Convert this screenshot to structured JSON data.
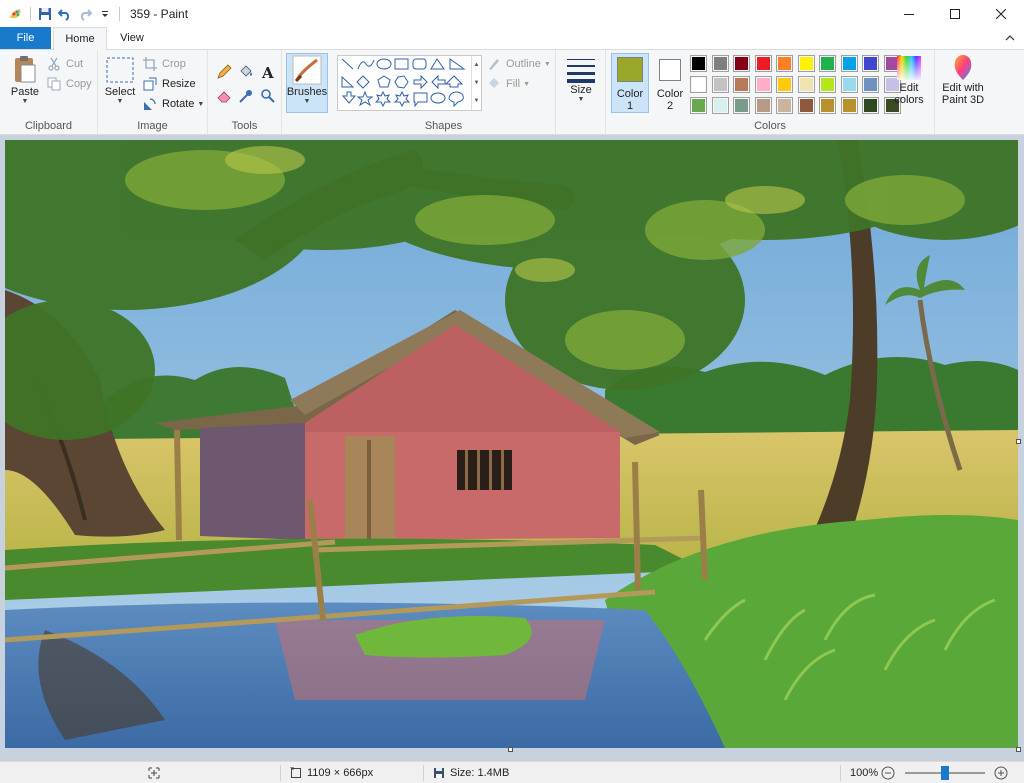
{
  "window": {
    "title": "359 - Paint"
  },
  "tabs": [
    {
      "label": "File"
    },
    {
      "label": "Home"
    },
    {
      "label": "View"
    }
  ],
  "ribbon": {
    "clipboard": {
      "label": "Clipboard",
      "paste": "Paste",
      "cut": "Cut",
      "copy": "Copy"
    },
    "image": {
      "label": "Image",
      "select": "Select",
      "crop": "Crop",
      "resize": "Resize",
      "rotate": "Rotate"
    },
    "tools": {
      "label": "Tools"
    },
    "brushes": {
      "label": "Brushes"
    },
    "shapes": {
      "label": "Shapes",
      "outline": "Outline",
      "fill": "Fill"
    },
    "size": {
      "label": "Size"
    },
    "colors": {
      "label": "Colors",
      "color1_line1": "Color",
      "color1_line2": "1",
      "color2_line1": "Color",
      "color2_line2": "2",
      "edit_line1": "Edit",
      "edit_line2": "colors",
      "paint3d_line1": "Edit with",
      "paint3d_line2": "Paint 3D",
      "color1_value": "#9aa82a",
      "color2_value": "#ffffff",
      "palette": [
        "#000000",
        "#7f7f7f",
        "#880015",
        "#ed1c24",
        "#ff7f27",
        "#fff200",
        "#22b14c",
        "#00a2e8",
        "#3f48cc",
        "#a349a4",
        "#ffffff",
        "#c3c3c3",
        "#b97a57",
        "#ffaec9",
        "#ffc90e",
        "#efe4b0",
        "#b5e61d",
        "#99d9ea",
        "#7092be",
        "#c8bfe7",
        "#6aa84f",
        "#d9efef",
        "#7a9a8c",
        "#b79a86",
        "#c9b59b",
        "#8f5a3c",
        "#b8912e",
        "#b7912a",
        "#2f4a20",
        "#3a4a22"
      ]
    }
  },
  "status": {
    "dimensions": "1109 × 666px",
    "size": "Size: 1.4MB",
    "zoom": "100%"
  }
}
